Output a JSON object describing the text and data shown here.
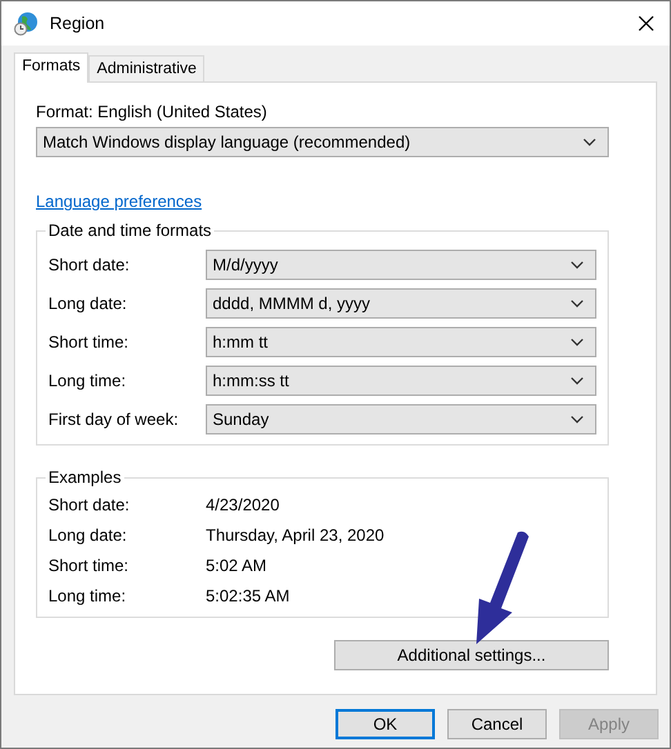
{
  "window": {
    "title": "Region"
  },
  "tabs": [
    {
      "label": "Formats",
      "selected": true
    },
    {
      "label": "Administrative",
      "selected": false
    }
  ],
  "format": {
    "label": "Format: English (United States)",
    "value": "Match Windows display language (recommended)"
  },
  "link": "Language preferences",
  "date_time_formats": {
    "title": "Date and time formats",
    "rows": [
      {
        "label": "Short date:",
        "value": "M/d/yyyy"
      },
      {
        "label": "Long date:",
        "value": "dddd, MMMM d, yyyy"
      },
      {
        "label": "Short time:",
        "value": "h:mm tt"
      },
      {
        "label": "Long time:",
        "value": "h:mm:ss tt"
      },
      {
        "label": "First day of week:",
        "value": "Sunday"
      }
    ]
  },
  "examples": {
    "title": "Examples",
    "rows": [
      {
        "label": "Short date:",
        "value": "4/23/2020"
      },
      {
        "label": "Long date:",
        "value": "Thursday, April 23, 2020"
      },
      {
        "label": "Short time:",
        "value": "5:02 AM"
      },
      {
        "label": "Long time:",
        "value": "5:02:35 AM"
      }
    ]
  },
  "additional_button": "Additional settings...",
  "buttons": [
    {
      "label": "OK",
      "default": true,
      "disabled": false
    },
    {
      "label": "Cancel",
      "default": false,
      "disabled": false
    },
    {
      "label": "Apply",
      "default": false,
      "disabled": true
    }
  ]
}
